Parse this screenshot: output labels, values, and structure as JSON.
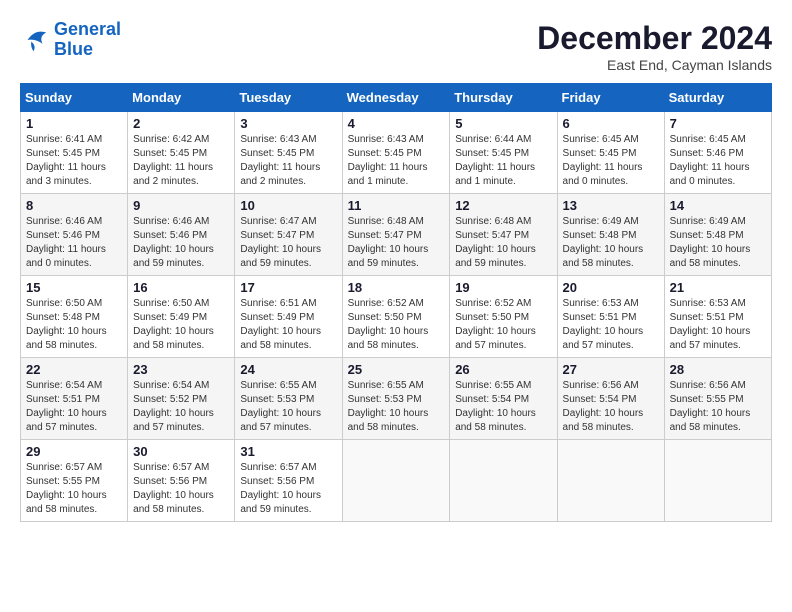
{
  "header": {
    "logo_line1": "General",
    "logo_line2": "Blue",
    "month": "December 2024",
    "location": "East End, Cayman Islands"
  },
  "weekdays": [
    "Sunday",
    "Monday",
    "Tuesday",
    "Wednesday",
    "Thursday",
    "Friday",
    "Saturday"
  ],
  "weeks": [
    [
      {
        "day": "1",
        "sunrise": "6:41 AM",
        "sunset": "5:45 PM",
        "daylight": "11 hours and 3 minutes."
      },
      {
        "day": "2",
        "sunrise": "6:42 AM",
        "sunset": "5:45 PM",
        "daylight": "11 hours and 2 minutes."
      },
      {
        "day": "3",
        "sunrise": "6:43 AM",
        "sunset": "5:45 PM",
        "daylight": "11 hours and 2 minutes."
      },
      {
        "day": "4",
        "sunrise": "6:43 AM",
        "sunset": "5:45 PM",
        "daylight": "11 hours and 1 minute."
      },
      {
        "day": "5",
        "sunrise": "6:44 AM",
        "sunset": "5:45 PM",
        "daylight": "11 hours and 1 minute."
      },
      {
        "day": "6",
        "sunrise": "6:45 AM",
        "sunset": "5:45 PM",
        "daylight": "11 hours and 0 minutes."
      },
      {
        "day": "7",
        "sunrise": "6:45 AM",
        "sunset": "5:46 PM",
        "daylight": "11 hours and 0 minutes."
      }
    ],
    [
      {
        "day": "8",
        "sunrise": "6:46 AM",
        "sunset": "5:46 PM",
        "daylight": "11 hours and 0 minutes."
      },
      {
        "day": "9",
        "sunrise": "6:46 AM",
        "sunset": "5:46 PM",
        "daylight": "10 hours and 59 minutes."
      },
      {
        "day": "10",
        "sunrise": "6:47 AM",
        "sunset": "5:47 PM",
        "daylight": "10 hours and 59 minutes."
      },
      {
        "day": "11",
        "sunrise": "6:48 AM",
        "sunset": "5:47 PM",
        "daylight": "10 hours and 59 minutes."
      },
      {
        "day": "12",
        "sunrise": "6:48 AM",
        "sunset": "5:47 PM",
        "daylight": "10 hours and 59 minutes."
      },
      {
        "day": "13",
        "sunrise": "6:49 AM",
        "sunset": "5:48 PM",
        "daylight": "10 hours and 58 minutes."
      },
      {
        "day": "14",
        "sunrise": "6:49 AM",
        "sunset": "5:48 PM",
        "daylight": "10 hours and 58 minutes."
      }
    ],
    [
      {
        "day": "15",
        "sunrise": "6:50 AM",
        "sunset": "5:48 PM",
        "daylight": "10 hours and 58 minutes."
      },
      {
        "day": "16",
        "sunrise": "6:50 AM",
        "sunset": "5:49 PM",
        "daylight": "10 hours and 58 minutes."
      },
      {
        "day": "17",
        "sunrise": "6:51 AM",
        "sunset": "5:49 PM",
        "daylight": "10 hours and 58 minutes."
      },
      {
        "day": "18",
        "sunrise": "6:52 AM",
        "sunset": "5:50 PM",
        "daylight": "10 hours and 58 minutes."
      },
      {
        "day": "19",
        "sunrise": "6:52 AM",
        "sunset": "5:50 PM",
        "daylight": "10 hours and 57 minutes."
      },
      {
        "day": "20",
        "sunrise": "6:53 AM",
        "sunset": "5:51 PM",
        "daylight": "10 hours and 57 minutes."
      },
      {
        "day": "21",
        "sunrise": "6:53 AM",
        "sunset": "5:51 PM",
        "daylight": "10 hours and 57 minutes."
      }
    ],
    [
      {
        "day": "22",
        "sunrise": "6:54 AM",
        "sunset": "5:51 PM",
        "daylight": "10 hours and 57 minutes."
      },
      {
        "day": "23",
        "sunrise": "6:54 AM",
        "sunset": "5:52 PM",
        "daylight": "10 hours and 57 minutes."
      },
      {
        "day": "24",
        "sunrise": "6:55 AM",
        "sunset": "5:53 PM",
        "daylight": "10 hours and 57 minutes."
      },
      {
        "day": "25",
        "sunrise": "6:55 AM",
        "sunset": "5:53 PM",
        "daylight": "10 hours and 58 minutes."
      },
      {
        "day": "26",
        "sunrise": "6:55 AM",
        "sunset": "5:54 PM",
        "daylight": "10 hours and 58 minutes."
      },
      {
        "day": "27",
        "sunrise": "6:56 AM",
        "sunset": "5:54 PM",
        "daylight": "10 hours and 58 minutes."
      },
      {
        "day": "28",
        "sunrise": "6:56 AM",
        "sunset": "5:55 PM",
        "daylight": "10 hours and 58 minutes."
      }
    ],
    [
      {
        "day": "29",
        "sunrise": "6:57 AM",
        "sunset": "5:55 PM",
        "daylight": "10 hours and 58 minutes."
      },
      {
        "day": "30",
        "sunrise": "6:57 AM",
        "sunset": "5:56 PM",
        "daylight": "10 hours and 58 minutes."
      },
      {
        "day": "31",
        "sunrise": "6:57 AM",
        "sunset": "5:56 PM",
        "daylight": "10 hours and 59 minutes."
      },
      null,
      null,
      null,
      null
    ]
  ]
}
